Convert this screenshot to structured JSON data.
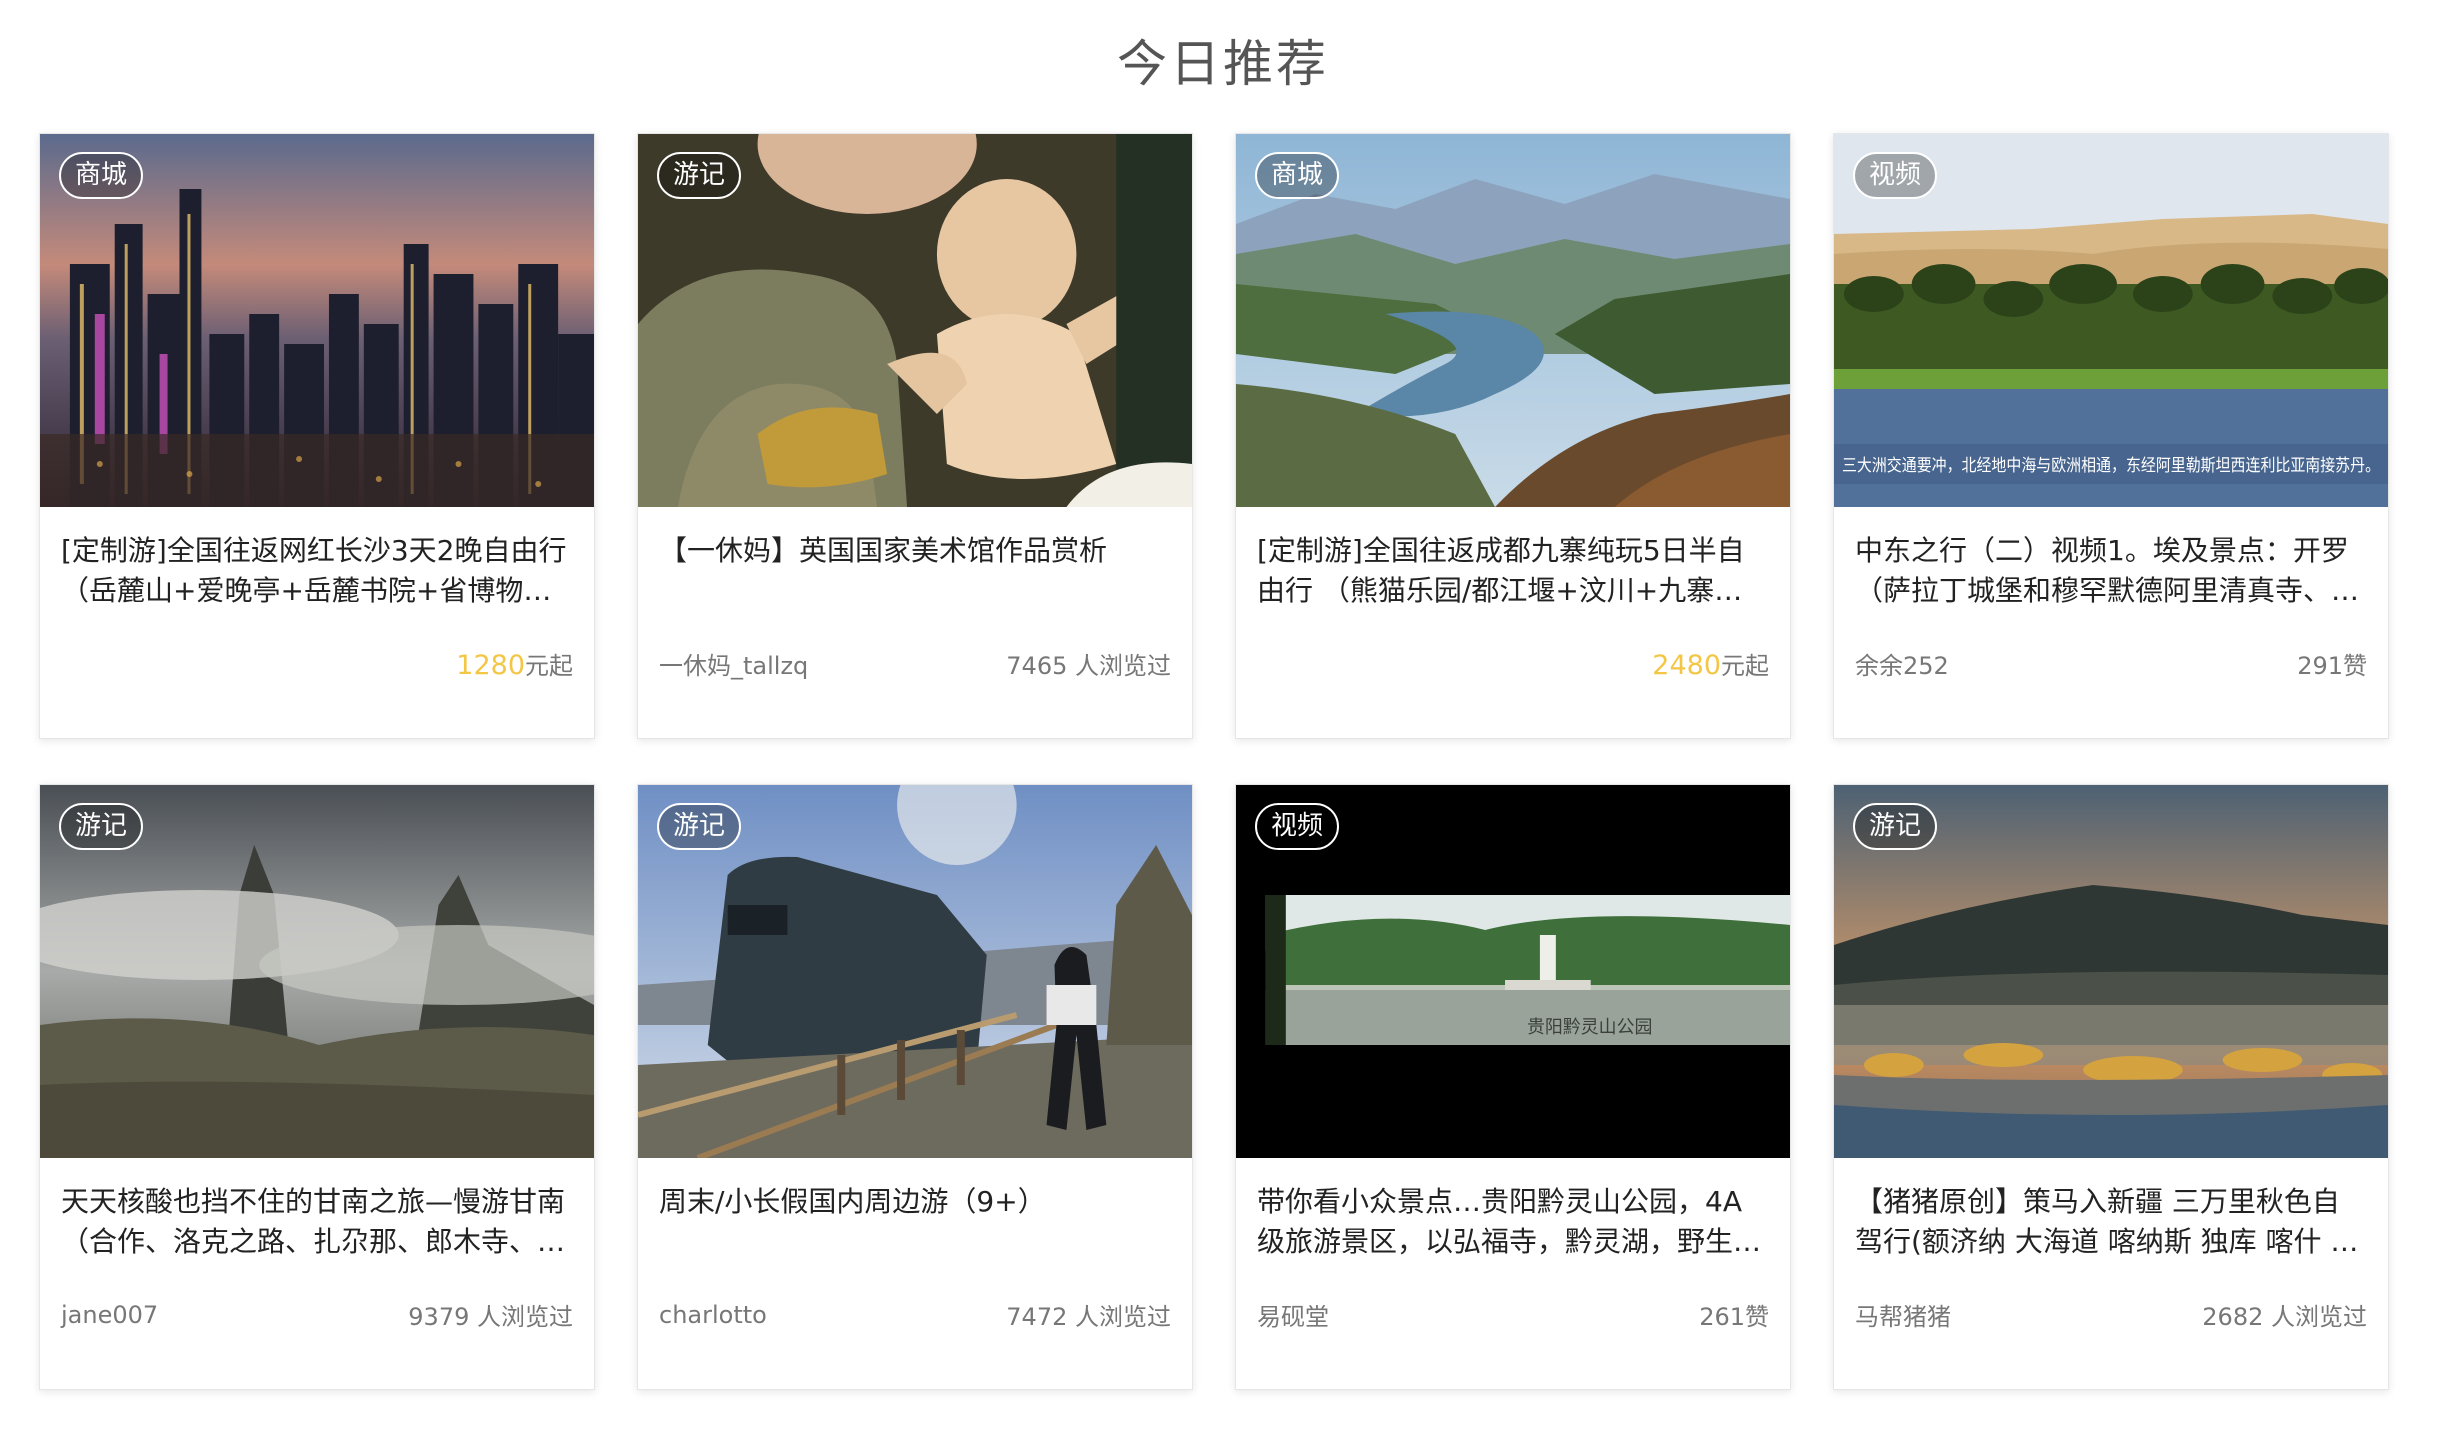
{
  "section": {
    "title": "今日推荐"
  },
  "cards": [
    {
      "tag": "商城",
      "title": "[定制游]全国往返网红长沙3天2晚自由行（岳麓山+爱晚亭+岳麓书院+省博物馆…",
      "price": "1280",
      "price_suffix": "元起",
      "image": "city-night-skyline"
    },
    {
      "tag": "游记",
      "title": "【一休妈】英国国家美术馆作品赏析",
      "author": "一休妈_tallzq",
      "stat": "7465 人浏览过",
      "image": "renaissance-madonna-painting"
    },
    {
      "tag": "商城",
      "title": "[定制游]全国往返成都九寨纯玩5日半自由行 （熊猫乐园/都江堰+汶川+九寨沟+…",
      "price": "2480",
      "price_suffix": "元起",
      "image": "river-valley-aerial"
    },
    {
      "tag": "视频",
      "title": "中东之行（二）视频1。埃及景点：开罗（萨拉丁城堡和穆罕默德阿里清真寺、…",
      "author": "余余252",
      "stat": "291赞",
      "image": "nile-palm-trees",
      "caption": "三大洲交通要冲，北经地中海与欧洲相通，东经阿里勒斯坦西连利比亚南接苏丹。"
    },
    {
      "tag": "游记",
      "title": "天天核酸也挡不住的甘南之旅—慢游甘南（合作、洛克之路、扎尕那、郎木寺、…",
      "author": "jane007",
      "stat": "9379 人浏览过",
      "image": "cloudy-mountains"
    },
    {
      "tag": "游记",
      "title": "周末/小长假国内周边游（9+）",
      "author": "charlotto",
      "stat": "7472 人浏览过",
      "image": "train-on-tracks"
    },
    {
      "tag": "视频",
      "title": "带你看小众景点…贵阳黔灵山公园，4A级旅游景区，以弘福寺，黔灵湖，野生…",
      "author": "易砚堂",
      "stat": "261赞",
      "image": "park-monument-video",
      "caption": "贵阳黔灵山公园"
    },
    {
      "tag": "游记",
      "title": "【猪猪原创】策马入新疆 三万里秋色自驾行(额济纳 大海道 喀纳斯 独库 喀什 …",
      "author": "马帮猪猪",
      "stat": "2682 人浏览过",
      "image": "autumn-valley-village"
    }
  ]
}
